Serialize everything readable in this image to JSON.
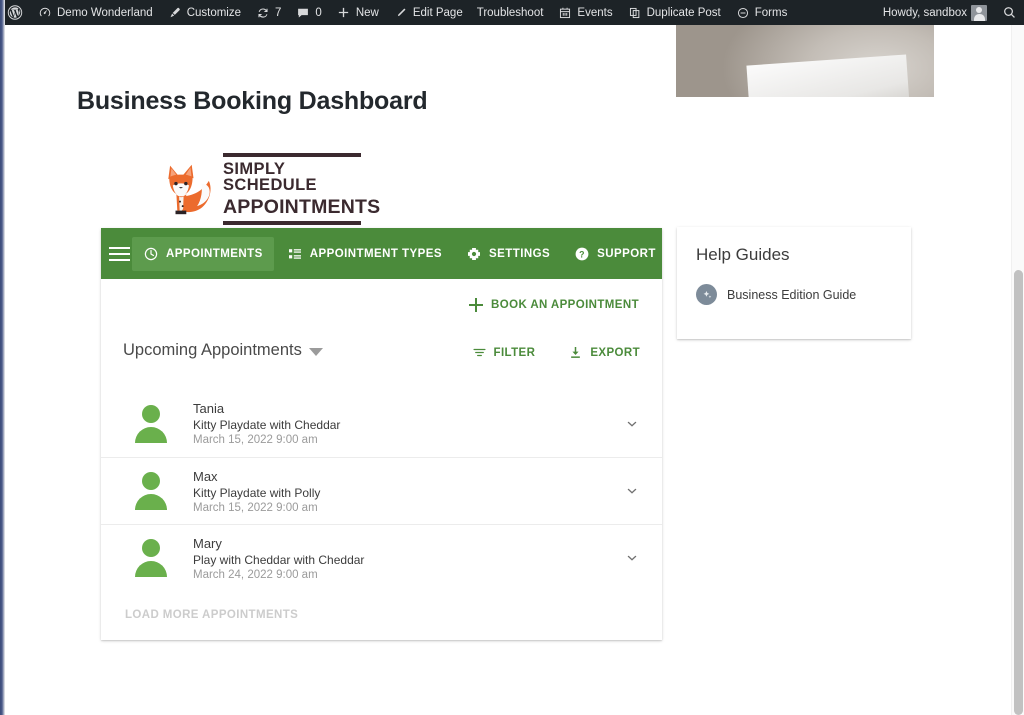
{
  "admin_bar": {
    "wp_logo": "wordpress-logo-icon",
    "items": [
      {
        "label": "Demo Wonderland",
        "icon": "dashboard-icon"
      },
      {
        "label": "Customize",
        "icon": "paintbrush-icon"
      },
      {
        "label": "7",
        "icon": "updates-icon"
      },
      {
        "label": "0",
        "icon": "comment-bubble-icon"
      },
      {
        "label": "New",
        "icon": "plus-icon"
      },
      {
        "label": "Edit Page",
        "icon": "pencil-icon"
      },
      {
        "label": "Troubleshoot",
        "icon": "none"
      },
      {
        "label": "Events",
        "icon": "calendar-icon"
      },
      {
        "label": "Duplicate Post",
        "icon": "copy-icon"
      },
      {
        "label": "Forms",
        "icon": "forms-icon"
      }
    ],
    "howdy": "Howdy, sandbox",
    "search_icon": "search-icon",
    "background_color": "#1d2327"
  },
  "page": {
    "title": "Business Booking Dashboard",
    "logo": {
      "wordmark_line1": "SIMPLY SCHEDULE",
      "wordmark_line2": "APPOINTMENTS",
      "mark": "fox-icon",
      "color": "#3b2a2f",
      "fox_color": "#ec6b2d"
    }
  },
  "ssa": {
    "accent_color": "#4b8b3b",
    "nav": {
      "menu_icon": "hamburger-icon",
      "items": [
        {
          "label": "APPOINTMENTS",
          "icon": "clock-icon",
          "active": true
        },
        {
          "label": "APPOINTMENT TYPES",
          "icon": "list-icon",
          "active": false
        },
        {
          "label": "SETTINGS",
          "icon": "gear-icon",
          "active": false
        },
        {
          "label": "SUPPORT",
          "icon": "question-circle-icon",
          "active": false
        }
      ]
    },
    "book_button": {
      "label": "BOOK AN APPOINTMENT",
      "icon": "plus-icon"
    },
    "list_heading": "Upcoming Appointments",
    "list_heading_caret": "caret-down-icon",
    "tools": [
      {
        "label": "FILTER",
        "icon": "filter-icon"
      },
      {
        "label": "EXPORT",
        "icon": "download-icon"
      }
    ],
    "appointments": [
      {
        "name": "Tania",
        "type": "Kitty Playdate with Cheddar",
        "time": "March 15, 2022 9:00 am",
        "avatar": "person-avatar-icon",
        "expand": "chevron-down-icon"
      },
      {
        "name": "Max",
        "type": "Kitty Playdate with Polly",
        "time": "March 15, 2022 9:00 am",
        "avatar": "person-avatar-icon",
        "expand": "chevron-down-icon"
      },
      {
        "name": "Mary",
        "type": "Play with Cheddar with Cheddar",
        "time": "March 24, 2022 9:00 am",
        "avatar": "person-avatar-icon",
        "expand": "chevron-down-icon"
      }
    ],
    "load_more": "LOAD MORE APPOINTMENTS"
  },
  "help_guides": {
    "title": "Help Guides",
    "link_label": "Business Edition Guide",
    "badge_icon": "guide-badge-icon"
  }
}
